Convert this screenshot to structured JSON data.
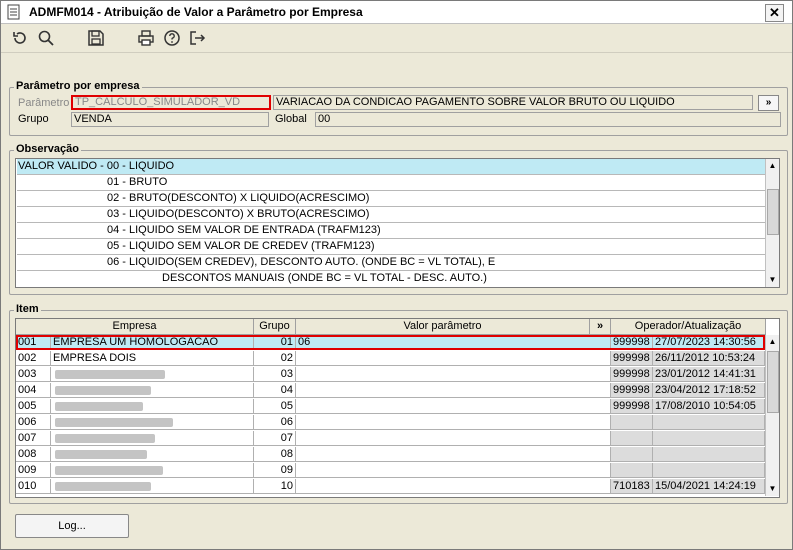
{
  "window": {
    "title": "ADMFM014 - Atribuição de Valor a Parâmetro por Empresa",
    "close": "✕"
  },
  "toolbar": {
    "icons": [
      "refresh-icon",
      "search-icon",
      "save-icon",
      "print-icon",
      "help-icon",
      "exit-icon"
    ]
  },
  "param_group": {
    "title": "Parâmetro por empresa",
    "param_label": "Parâmetro",
    "param_value": "TP_CALCULO_SIMULADOR_VD",
    "param_desc": "VARIACAO DA CONDICAO PAGAMENTO SOBRE VALOR BRUTO OU LIQUIDO",
    "more_button": "»",
    "group_label": "Grupo",
    "group_value": "VENDA",
    "global_label": "Global",
    "global_value": "00"
  },
  "obs_group": {
    "title": "Observação",
    "lines": [
      "VALOR VALIDO -  00 - LIQUIDO",
      "01 - BRUTO",
      "02 - BRUTO(DESCONTO) X LIQUIDO(ACRESCIMO)",
      "03 - LIQUIDO(DESCONTO) X BRUTO(ACRESCIMO)",
      "04 - LIQUIDO SEM VALOR DE ENTRADA (TRAFM123)",
      "05 - LIQUIDO SEM VALOR DE CREDEV (TRAFM123)",
      "06 - LIQUIDO(SEM CREDEV), DESCONTO AUTO. (ONDE BC = VL TOTAL), E",
      "DESCONTOS MANUAIS (ONDE BC = VL TOTAL - DESC. AUTO.)"
    ]
  },
  "item_group": {
    "title": "Item",
    "headers": {
      "empresa": "Empresa",
      "grupo": "Grupo",
      "valor": "Valor parâmetro",
      "more": "»",
      "operador": "Operador/Atualização"
    },
    "rows": [
      {
        "code": "001",
        "name": "EMPRESA UM HOMOLOGACAO",
        "grupo": "01",
        "valor": "06",
        "op": "999998",
        "data": "27/07/2023 14:30:56"
      },
      {
        "code": "002",
        "name": "EMPRESA DOIS",
        "grupo": "02",
        "valor": "",
        "op": "999998",
        "data": "26/11/2012 10:53:24"
      },
      {
        "code": "003",
        "name": "",
        "grupo": "03",
        "valor": "",
        "op": "999998",
        "data": "23/01/2012 14:41:31"
      },
      {
        "code": "004",
        "name": "",
        "grupo": "04",
        "valor": "",
        "op": "999998",
        "data": "23/04/2012 17:18:52"
      },
      {
        "code": "005",
        "name": "",
        "grupo": "05",
        "valor": "",
        "op": "999998",
        "data": "17/08/2010 10:54:05"
      },
      {
        "code": "006",
        "name": "",
        "grupo": "06",
        "valor": "",
        "op": "",
        "data": ""
      },
      {
        "code": "007",
        "name": "",
        "grupo": "07",
        "valor": "",
        "op": "",
        "data": ""
      },
      {
        "code": "008",
        "name": "",
        "grupo": "08",
        "valor": "",
        "op": "",
        "data": ""
      },
      {
        "code": "009",
        "name": "",
        "grupo": "09",
        "valor": "",
        "op": "",
        "data": ""
      },
      {
        "code": "010",
        "name": "",
        "grupo": "10",
        "valor": "",
        "op": "710183",
        "data": "15/04/2021 14:24:19"
      }
    ]
  },
  "log_button": "Log..."
}
